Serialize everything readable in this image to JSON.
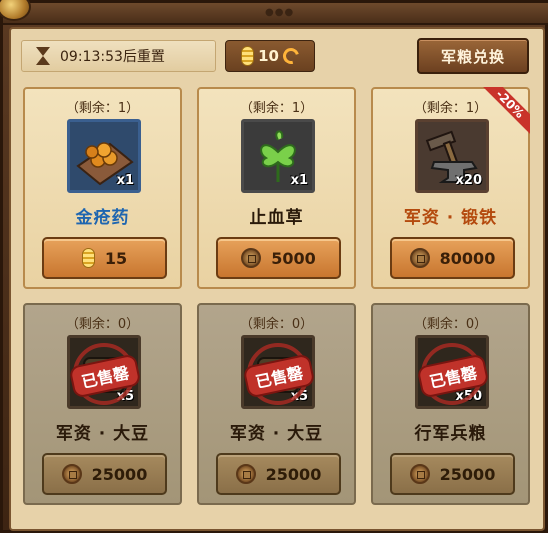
{
  "header": {
    "timer_text": "09:13:53后重置",
    "token_count": "10",
    "supply_button": "军粮兑换"
  },
  "cards": [
    {
      "remaining": "（剩余：1）",
      "name": "金疮药",
      "qty": "x1",
      "price": "15",
      "currency": "gold-pill-icon",
      "sold": false,
      "name_color": "#1f66b0"
    },
    {
      "remaining": "（剩余：1）",
      "name": "止血草",
      "qty": "x1",
      "price": "5000",
      "currency": "copper-coin-icon",
      "sold": false,
      "name_color": "#2a1a0a"
    },
    {
      "remaining": "（剩余：1）",
      "name": "军资 · 锻铁",
      "qty": "x20",
      "price": "80000",
      "currency": "copper-coin-icon",
      "sold": false,
      "name_color": "#b44a0e",
      "discount": "-20%"
    },
    {
      "remaining": "（剩余：0）",
      "name": "军资 · 大豆",
      "qty": "x5",
      "price": "25000",
      "currency": "copper-coin-icon",
      "sold": true,
      "name_color": "#2a1a0a"
    },
    {
      "remaining": "（剩余：0）",
      "name": "军资 · 大豆",
      "qty": "x5",
      "price": "25000",
      "currency": "copper-coin-icon",
      "sold": true,
      "name_color": "#2a1a0a"
    },
    {
      "remaining": "（剩余：0）",
      "name": "行军兵粮",
      "qty": "x50",
      "price": "25000",
      "currency": "copper-coin-icon",
      "sold": true,
      "name_color": "#2a1a0a"
    }
  ],
  "sold_label": "已售罄",
  "colors": {
    "panel": "#e7d2a9",
    "button": "#d68a40",
    "sold_red": "#c0322a"
  }
}
